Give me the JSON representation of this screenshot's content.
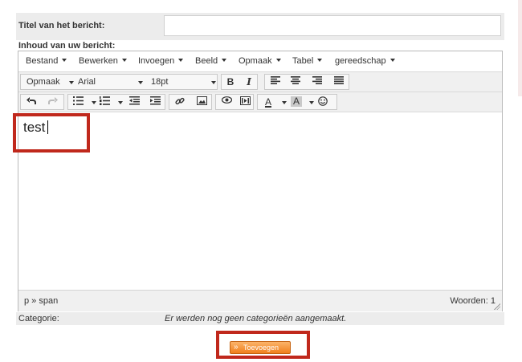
{
  "form": {
    "title_label": "Titel van het bericht:",
    "title_value": "",
    "content_label": "Inhoud van uw bericht:",
    "category_label": "Categorie:",
    "category_value": "Er werden nog geen categorieën aangemaakt.",
    "submit_label": "Toevoegen"
  },
  "editor": {
    "menu": [
      "Bestand",
      "Bewerken",
      "Invoegen",
      "Beeld",
      "Opmaak",
      "Tabel",
      "gereedschap"
    ],
    "format_dropdown": "Opmaak",
    "font_family": "Arial",
    "font_size": "18pt",
    "bold_label": "B",
    "italic_label": "I",
    "font_color_label": "A",
    "background_color_label": "A",
    "body_text": "test",
    "status_path": "p » span",
    "word_count": "Woorden: 1"
  },
  "icons": [
    "bold-icon",
    "italic-icon",
    "align-left-icon",
    "align-center-icon",
    "align-right-icon",
    "justify-icon",
    "undo-icon",
    "redo-icon",
    "bullet-list-icon",
    "numbered-list-icon",
    "outdent-icon",
    "indent-icon",
    "link-icon",
    "image-icon",
    "preview-icon",
    "media-icon",
    "text-color-icon",
    "background-color-icon",
    "emoticon-icon"
  ],
  "colors": {
    "highlight": "#c0281c",
    "submit": "#f07f1c",
    "row_background": "#ececec"
  }
}
